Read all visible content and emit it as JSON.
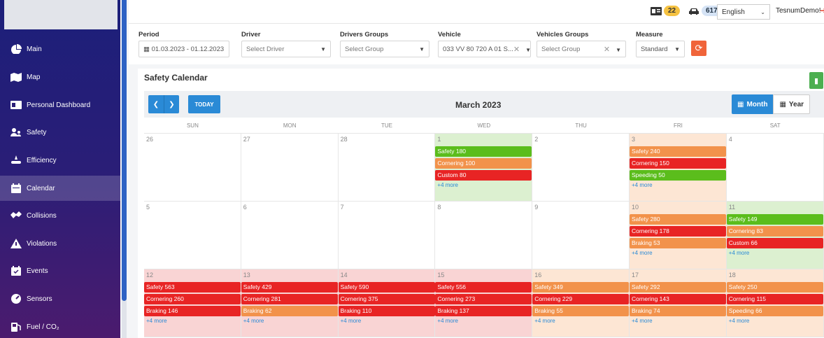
{
  "sidebar": {
    "items": [
      {
        "label": "Main",
        "icon": "dashboard-icon"
      },
      {
        "label": "Map",
        "icon": "map-icon"
      },
      {
        "label": "Personal Dashboard",
        "icon": "id-card-icon"
      },
      {
        "label": "Safety",
        "icon": "safety-users-icon"
      },
      {
        "label": "Efficiency",
        "icon": "efficiency-icon"
      },
      {
        "label": "Calendar",
        "icon": "calendar-icon",
        "active": true
      },
      {
        "label": "Collisions",
        "icon": "collision-icon"
      },
      {
        "label": "Violations",
        "icon": "warning-icon"
      },
      {
        "label": "Events",
        "icon": "events-icon"
      },
      {
        "label": "Sensors",
        "icon": "gauge-icon"
      },
      {
        "label": "Fuel / CO₂",
        "icon": "fuel-icon"
      }
    ]
  },
  "topbar": {
    "badge1": "22",
    "badge2": "617",
    "language": "English",
    "user": "TesnumDemo!",
    "colors": {
      "badge1": "#f5c242",
      "badge2": "#d5e3f5"
    }
  },
  "filters": {
    "period_label": "Period",
    "period_value": "01.03.2023 - 01.12.2023",
    "driver_label": "Driver",
    "driver_placeholder": "Select Driver",
    "drivers_groups_label": "Drivers Groups",
    "drivers_groups_placeholder": "Select Group",
    "vehicle_label": "Vehicle",
    "vehicle_value": "033 VV 80 720 A 01 S...",
    "vehicles_groups_label": "Vehicles Groups",
    "vehicles_groups_placeholder": "Select Group",
    "measure_label": "Measure",
    "measure_value": "Standard"
  },
  "calendar": {
    "title": "Safety Calendar",
    "today": "TODAY",
    "month_title": "March 2023",
    "view_month": "Month",
    "view_year": "Year",
    "weekdays": [
      "SUN",
      "MON",
      "TUE",
      "WED",
      "THU",
      "FRI",
      "SAT"
    ],
    "more_label": "+4 more",
    "colors": {
      "green": "#5bbd1c",
      "orange": "#f2924b",
      "red": "#e82424",
      "green_bg": "#dcf0d0",
      "orange_bg": "#fde6d4",
      "red_bg": "#f9d4d4"
    },
    "weeks": [
      [
        {
          "day": "26"
        },
        {
          "day": "27"
        },
        {
          "day": "28"
        },
        {
          "day": "1",
          "bg": "green",
          "events": [
            {
              "label": "Safety 180",
              "color": "green"
            },
            {
              "label": "Cornering 100",
              "color": "orange"
            },
            {
              "label": "Custom 80",
              "color": "red"
            }
          ],
          "more": true
        },
        {
          "day": "2"
        },
        {
          "day": "3",
          "bg": "orange",
          "events": [
            {
              "label": "Safety 240",
              "color": "orange"
            },
            {
              "label": "Cornering 150",
              "color": "red"
            },
            {
              "label": "Speeding 50",
              "color": "green"
            }
          ],
          "more": true
        },
        {
          "day": "4"
        }
      ],
      [
        {
          "day": "5"
        },
        {
          "day": "6"
        },
        {
          "day": "7"
        },
        {
          "day": "8"
        },
        {
          "day": "9"
        },
        {
          "day": "10",
          "bg": "orange",
          "events": [
            {
              "label": "Safety 280",
              "color": "orange"
            },
            {
              "label": "Cornering 178",
              "color": "red"
            },
            {
              "label": "Braking 53",
              "color": "orange"
            }
          ],
          "more": true
        },
        {
          "day": "11",
          "bg": "green",
          "events": [
            {
              "label": "Safety 149",
              "color": "green"
            },
            {
              "label": "Cornering 83",
              "color": "orange"
            },
            {
              "label": "Custom 66",
              "color": "red"
            }
          ],
          "more": true
        }
      ],
      [
        {
          "day": "12",
          "bg": "red",
          "events": [
            {
              "label": "Safety 563",
              "color": "red"
            },
            {
              "label": "Cornering 260",
              "color": "red"
            },
            {
              "label": "Braking 146",
              "color": "red"
            }
          ],
          "more": true
        },
        {
          "day": "13",
          "bg": "red",
          "events": [
            {
              "label": "Safety 429",
              "color": "red"
            },
            {
              "label": "Cornering 281",
              "color": "red"
            },
            {
              "label": "Braking 62",
              "color": "orange"
            }
          ],
          "more": true
        },
        {
          "day": "14",
          "bg": "red",
          "events": [
            {
              "label": "Safety 590",
              "color": "red"
            },
            {
              "label": "Cornering 375",
              "color": "red"
            },
            {
              "label": "Braking 110",
              "color": "red"
            }
          ],
          "more": true
        },
        {
          "day": "15",
          "bg": "red",
          "events": [
            {
              "label": "Safety 556",
              "color": "red"
            },
            {
              "label": "Cornering 273",
              "color": "red"
            },
            {
              "label": "Braking 137",
              "color": "red"
            }
          ],
          "more": true
        },
        {
          "day": "16",
          "bg": "orange",
          "events": [
            {
              "label": "Safety 349",
              "color": "orange"
            },
            {
              "label": "Cornering 229",
              "color": "red"
            },
            {
              "label": "Braking 55",
              "color": "orange"
            }
          ],
          "more": true
        },
        {
          "day": "17",
          "bg": "orange",
          "events": [
            {
              "label": "Safety 292",
              "color": "orange"
            },
            {
              "label": "Cornering 143",
              "color": "red"
            },
            {
              "label": "Braking 74",
              "color": "orange"
            }
          ],
          "more": true
        },
        {
          "day": "18",
          "bg": "orange",
          "events": [
            {
              "label": "Safety 250",
              "color": "orange"
            },
            {
              "label": "Cornering 115",
              "color": "red"
            },
            {
              "label": "Speeding 66",
              "color": "orange"
            }
          ],
          "more": true
        }
      ]
    ]
  }
}
